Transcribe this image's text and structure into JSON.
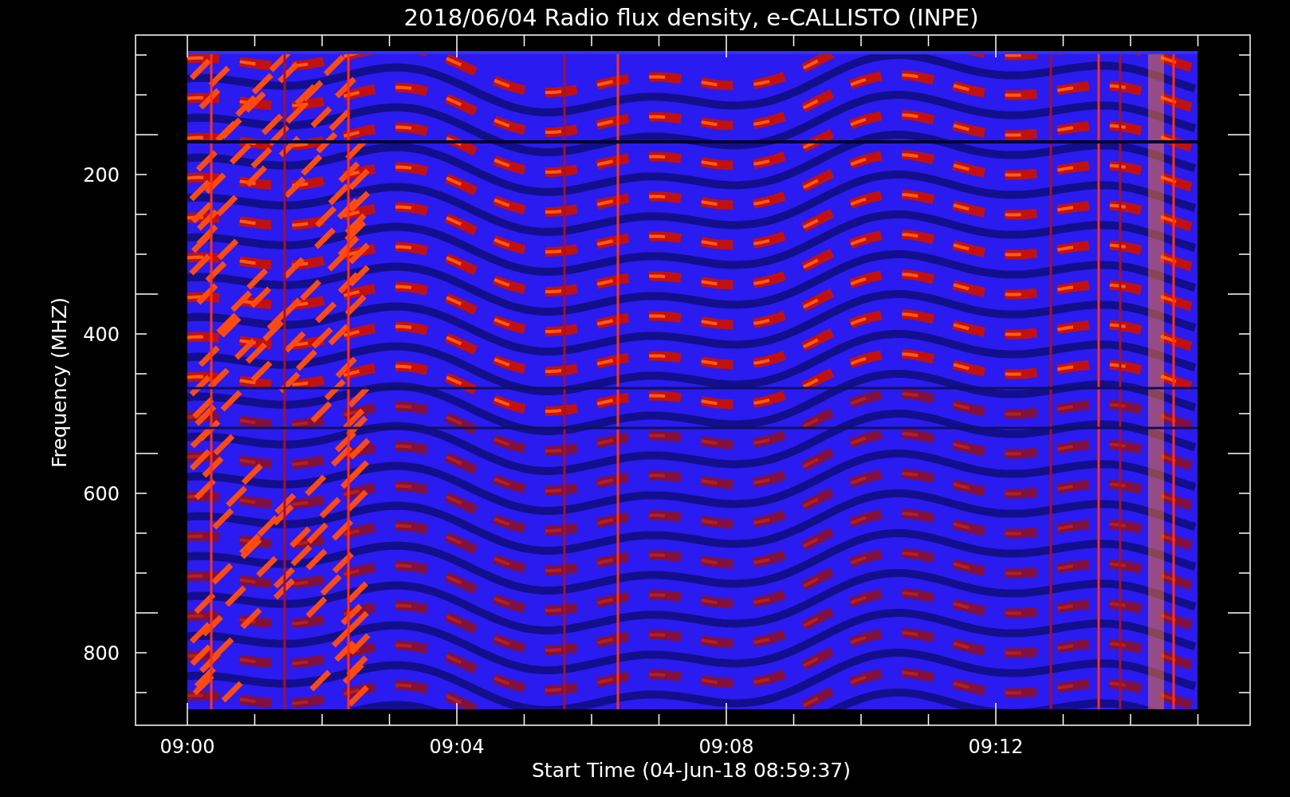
{
  "plot": {
    "title": "2018/06/04  Radio flux density, e-CALLISTO (INPE)",
    "y_axis": {
      "label": "Frequency (MHZ)",
      "tick_labels": [
        "200",
        "400",
        "600",
        "800"
      ]
    },
    "x_axis": {
      "label": "Start Time (04-Jun-18 08:59:37)",
      "tick_labels": [
        "09:00",
        "09:04",
        "09:08",
        "09:12"
      ]
    }
  }
}
